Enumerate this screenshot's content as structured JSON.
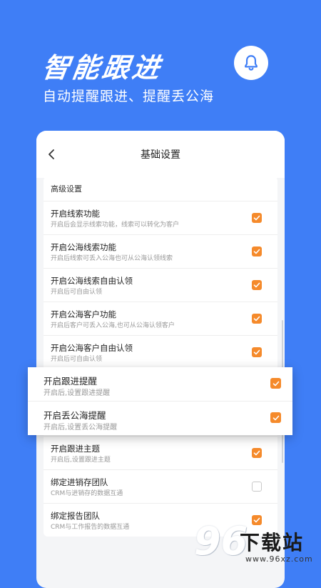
{
  "hero": {
    "title": "智能跟进",
    "subtitle": "自动提醒跟进、提醒丢公海"
  },
  "header": {
    "title": "基础设置"
  },
  "section": {
    "title": "高级设置"
  },
  "settings": [
    {
      "title": "开启线索功能",
      "desc": "开启后会显示线索功能，线索可以转化为客户",
      "checked": true
    },
    {
      "title": "开启公海线索功能",
      "desc": "开启后线索可丢入公海也可从公海认领线索",
      "checked": true
    },
    {
      "title": "开启公海线索自由认领",
      "desc": "开启后可自由认领",
      "checked": true
    },
    {
      "title": "开启公海客户功能",
      "desc": "开启后客户可丢入公海,也可从公海认领客户",
      "checked": true
    },
    {
      "title": "开启公海客户自由认领",
      "desc": "开启后可自由认领",
      "checked": true
    },
    {
      "title": "",
      "desc": "",
      "checked": false
    },
    {
      "title": "",
      "desc": "",
      "checked": false
    },
    {
      "title": "开启跟进主题",
      "desc": "开启后,设置跟进主题",
      "checked": true
    },
    {
      "title": "绑定进销存团队",
      "desc": "CRM与进销存的数据互通",
      "checked": false
    },
    {
      "title": "绑定报告团队",
      "desc": "CRM与工作报告的数据互通",
      "checked": true
    }
  ],
  "popout": [
    {
      "title": "开启跟进提醒",
      "desc": "开启后,设置跟进提醒",
      "checked": true
    },
    {
      "title": "开启丢公海提醒",
      "desc": "开启后,设置丢公海提醒",
      "checked": true
    }
  ],
  "watermark": {
    "number": "96",
    "text": "下载站",
    "domain": "www.96xz.com"
  },
  "colors": {
    "background": "#3f7ef6",
    "checkbox": "#f58a2b"
  },
  "icons": {
    "bell": "bell-icon",
    "back": "chevron-left-icon",
    "check": "check-icon"
  }
}
